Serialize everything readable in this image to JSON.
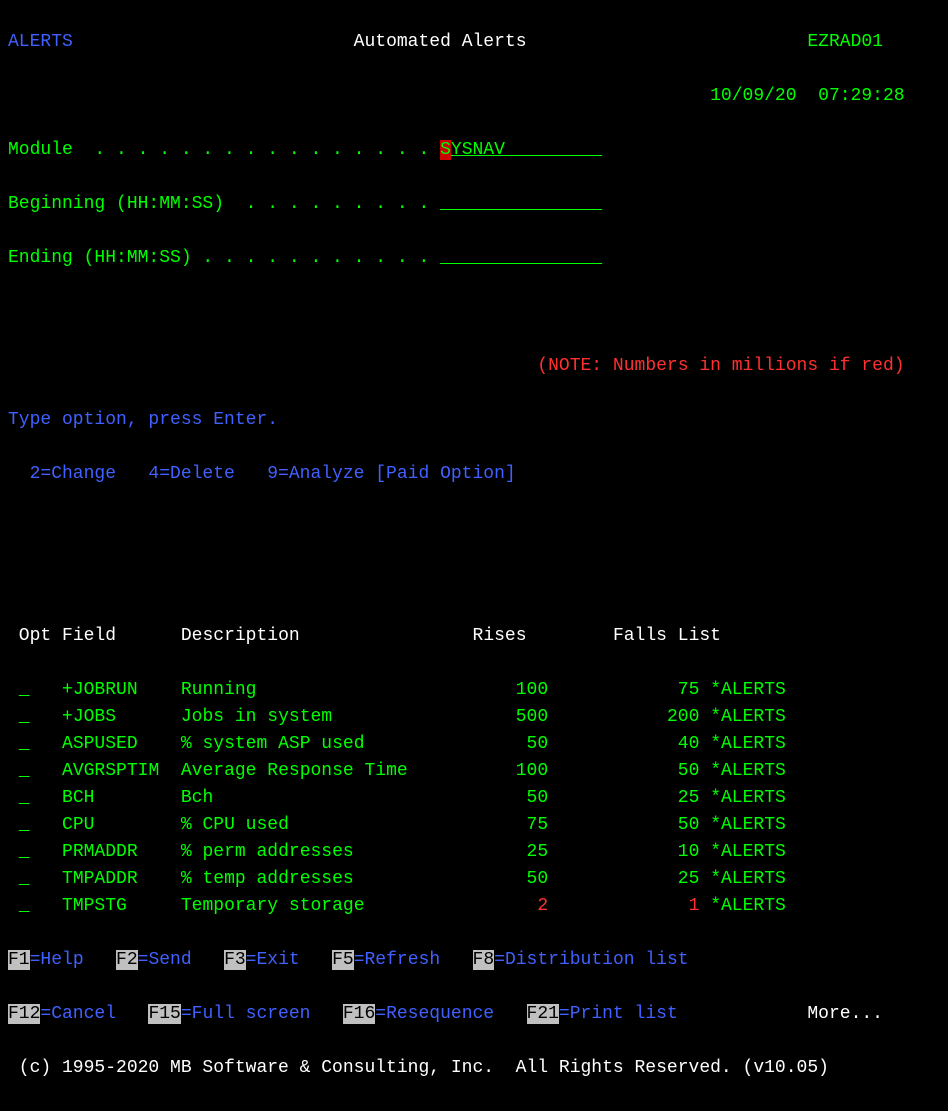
{
  "header": {
    "left": "ALERTS",
    "title": "Automated Alerts",
    "right": "EZRAD01",
    "date": "10/09/20",
    "time": "07:29:28"
  },
  "form": {
    "module_label": "Module  . . . . . . . . . . . . . . . .",
    "module_value_first": "S",
    "module_value_rest": "YSNAV",
    "module_pad": "         ",
    "begin_label": "Beginning (HH:MM:SS)  . . . . . . . . .",
    "begin_pad": "               ",
    "end_label": "Ending (HH:MM:SS) . . . . . . . . . . .",
    "end_pad": "               "
  },
  "note": "(NOTE: Numbers in millions if red)",
  "prompt": {
    "line": "Type option, press Enter.",
    "opts": "  2=Change   4=Delete   9=Analyze [Paid Option]"
  },
  "cols": {
    "opt": " Opt",
    "field": "Field",
    "desc": "Description",
    "rises": "Rises",
    "falls": "Falls",
    "list": "List"
  },
  "rows": [
    {
      "field": "+JOBRUN   ",
      "desc": "Running               ",
      "rises": "100",
      "falls": "75",
      "list": "*ALERTS",
      "red": false
    },
    {
      "field": "+JOBS     ",
      "desc": "Jobs in system        ",
      "rises": "500",
      "falls": "200",
      "list": "*ALERTS",
      "red": false
    },
    {
      "field": "ASPUSED   ",
      "desc": "% system ASP used     ",
      "rises": "50",
      "falls": "40",
      "list": "*ALERTS",
      "red": false
    },
    {
      "field": "AVGRSPTIM ",
      "desc": "Average Response Time ",
      "rises": "100",
      "falls": "50",
      "list": "*ALERTS",
      "red": false
    },
    {
      "field": "BCH       ",
      "desc": "Bch                   ",
      "rises": "50",
      "falls": "25",
      "list": "*ALERTS",
      "red": false
    },
    {
      "field": "CPU       ",
      "desc": "% CPU used            ",
      "rises": "75",
      "falls": "50",
      "list": "*ALERTS",
      "red": false
    },
    {
      "field": "PRMADDR   ",
      "desc": "% perm addresses      ",
      "rises": "25",
      "falls": "10",
      "list": "*ALERTS",
      "red": false
    },
    {
      "field": "TMPADDR   ",
      "desc": "% temp addresses      ",
      "rises": "50",
      "falls": "25",
      "list": "*ALERTS",
      "red": false
    },
    {
      "field": "TMPSTG    ",
      "desc": "Temporary storage     ",
      "rises": "2",
      "falls": "1",
      "list": "*ALERTS",
      "red": true
    }
  ],
  "fkeys1": [
    {
      "k": "F1",
      "t": "=Help"
    },
    {
      "k": "F2",
      "t": "=Send"
    },
    {
      "k": "F3",
      "t": "=Exit"
    },
    {
      "k": "F5",
      "t": "=Refresh"
    },
    {
      "k": "F8",
      "t": "=Distribution list"
    }
  ],
  "fkeys2": [
    {
      "k": "F12",
      "t": "=Cancel"
    },
    {
      "k": "F15",
      "t": "=Full screen"
    },
    {
      "k": "F16",
      "t": "=Resequence"
    },
    {
      "k": "F21",
      "t": "=Print list"
    }
  ],
  "more": "More...",
  "copyright": " (c) 1995-2020 MB Software & Consulting, Inc.  All Rights Reserved. (v10.05)"
}
